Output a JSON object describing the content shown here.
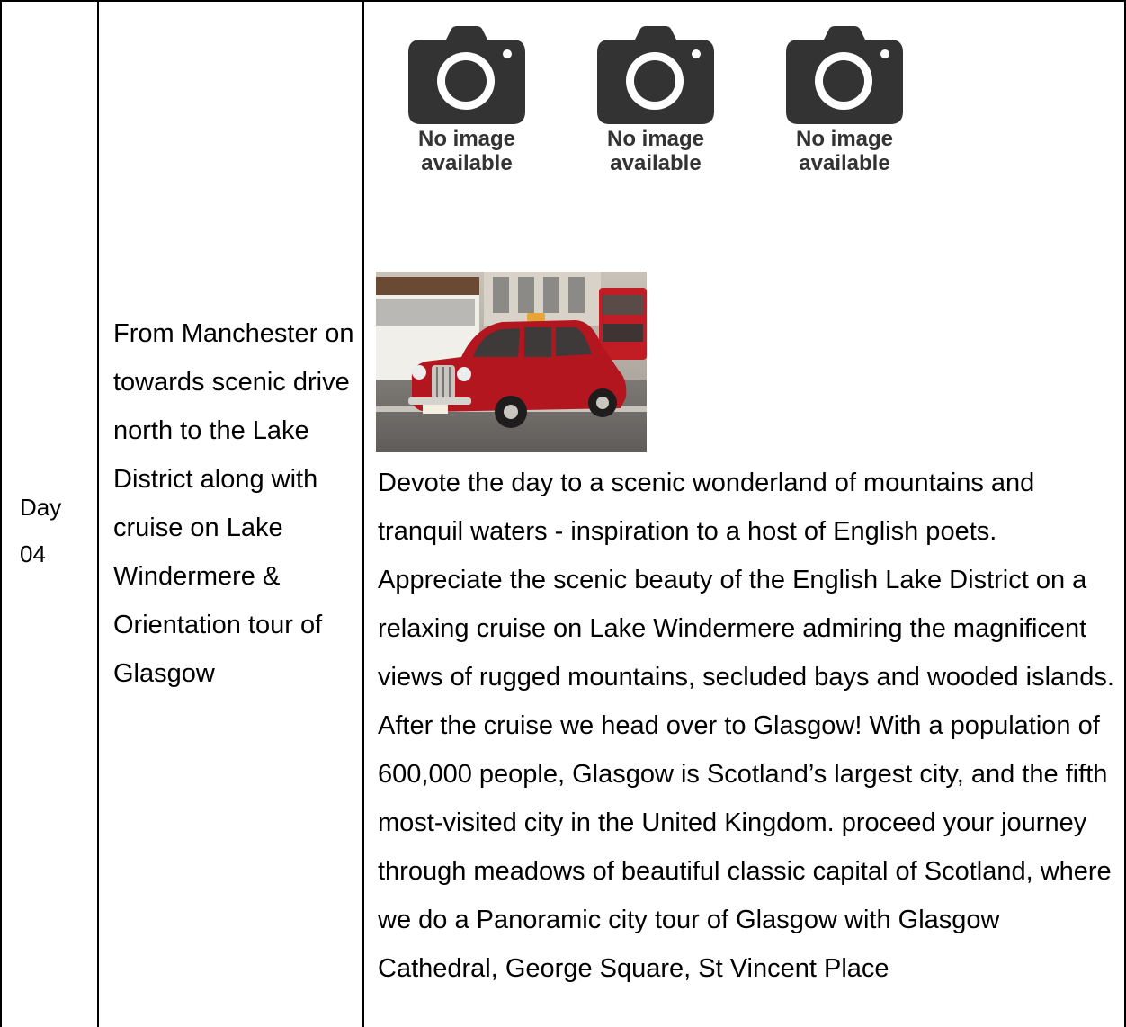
{
  "row": {
    "day_label": "Day 04",
    "summary": "From Manchester on towards scenic drive north to the Lake District along with cruise on Lake Windermere & Orientation tour of Glasgow",
    "placeholders": [
      {
        "text": "No image available",
        "icon": "camera-icon"
      },
      {
        "text": "No image available",
        "icon": "camera-icon"
      },
      {
        "text": "No image available",
        "icon": "camera-icon"
      }
    ],
    "photo_icon": "red-taxi-photo",
    "description": "Devote the day to a scenic wonderland of mountains and tranquil waters - inspiration to a host of English poets. Appreciate the scenic beauty of the English Lake District on a relaxing cruise on Lake Windermere admiring the magnificent views of rugged mountains, secluded bays and wooded islands. After the cruise we head over to Glasgow! With a population of 600,000 people, Glasgow is Scotland’s largest city, and the fifth most-visited city in the United Kingdom. proceed your journey through meadows of beautiful classic capital of Scotland, where we do a Panoramic city tour of Glasgow with Glasgow Cathedral, George Square, St Vincent Place"
  },
  "colors": {
    "border": "#000000",
    "placeholder_icon": "#333333",
    "taxi_red": "#b3161f"
  }
}
